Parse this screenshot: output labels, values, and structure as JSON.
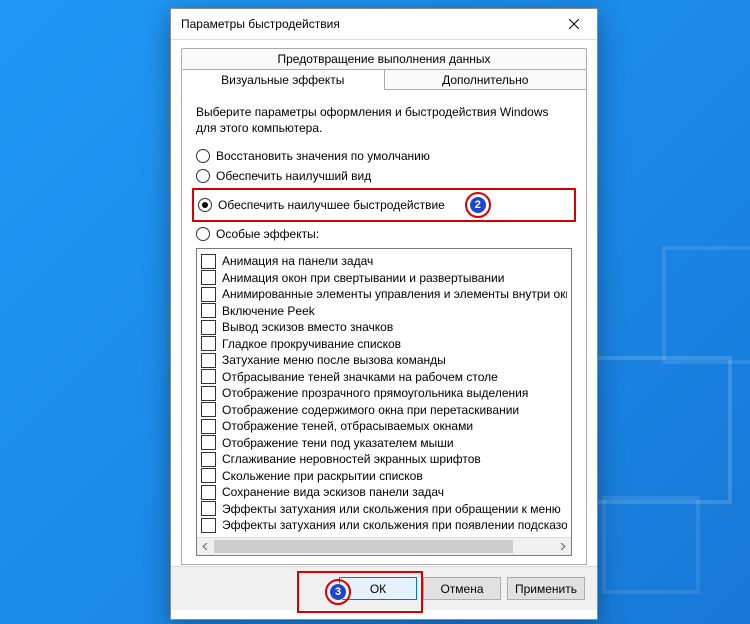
{
  "window": {
    "title": "Параметры быстродействия"
  },
  "tabs": {
    "dep": "Предотвращение выполнения данных",
    "visual": "Визуальные эффекты",
    "advanced": "Дополнительно"
  },
  "intro": "Выберите параметры оформления и быстродействия Windows для этого компьютера.",
  "radios": {
    "default": "Восстановить значения по умолчанию",
    "best_look": "Обеспечить наилучший вид",
    "best_perf": "Обеспечить наилучшее быстродействие",
    "custom": "Особые эффекты:"
  },
  "effects": [
    "Анимация на панели задач",
    "Анимация окон при свертывании и развертывании",
    "Анимированные элементы управления и элементы внутри окн",
    "Включение Peek",
    "Вывод эскизов вместо значков",
    "Гладкое прокручивание списков",
    "Затухание меню после вызова команды",
    "Отбрасывание теней значками на рабочем столе",
    "Отображение прозрачного прямоугольника выделения",
    "Отображение содержимого окна при перетаскивании",
    "Отображение теней, отбрасываемых окнами",
    "Отображение тени под указателем мыши",
    "Сглаживание неровностей экранных шрифтов",
    "Скольжение при раскрытии списков",
    "Сохранение вида эскизов панели задач",
    "Эффекты затухания или скольжения при обращении к меню",
    "Эффекты затухания или скольжения при появлении подсказок"
  ],
  "buttons": {
    "ok": "ОК",
    "cancel": "Отмена",
    "apply": "Применить"
  },
  "callouts": {
    "step2": "2",
    "step3": "3"
  }
}
